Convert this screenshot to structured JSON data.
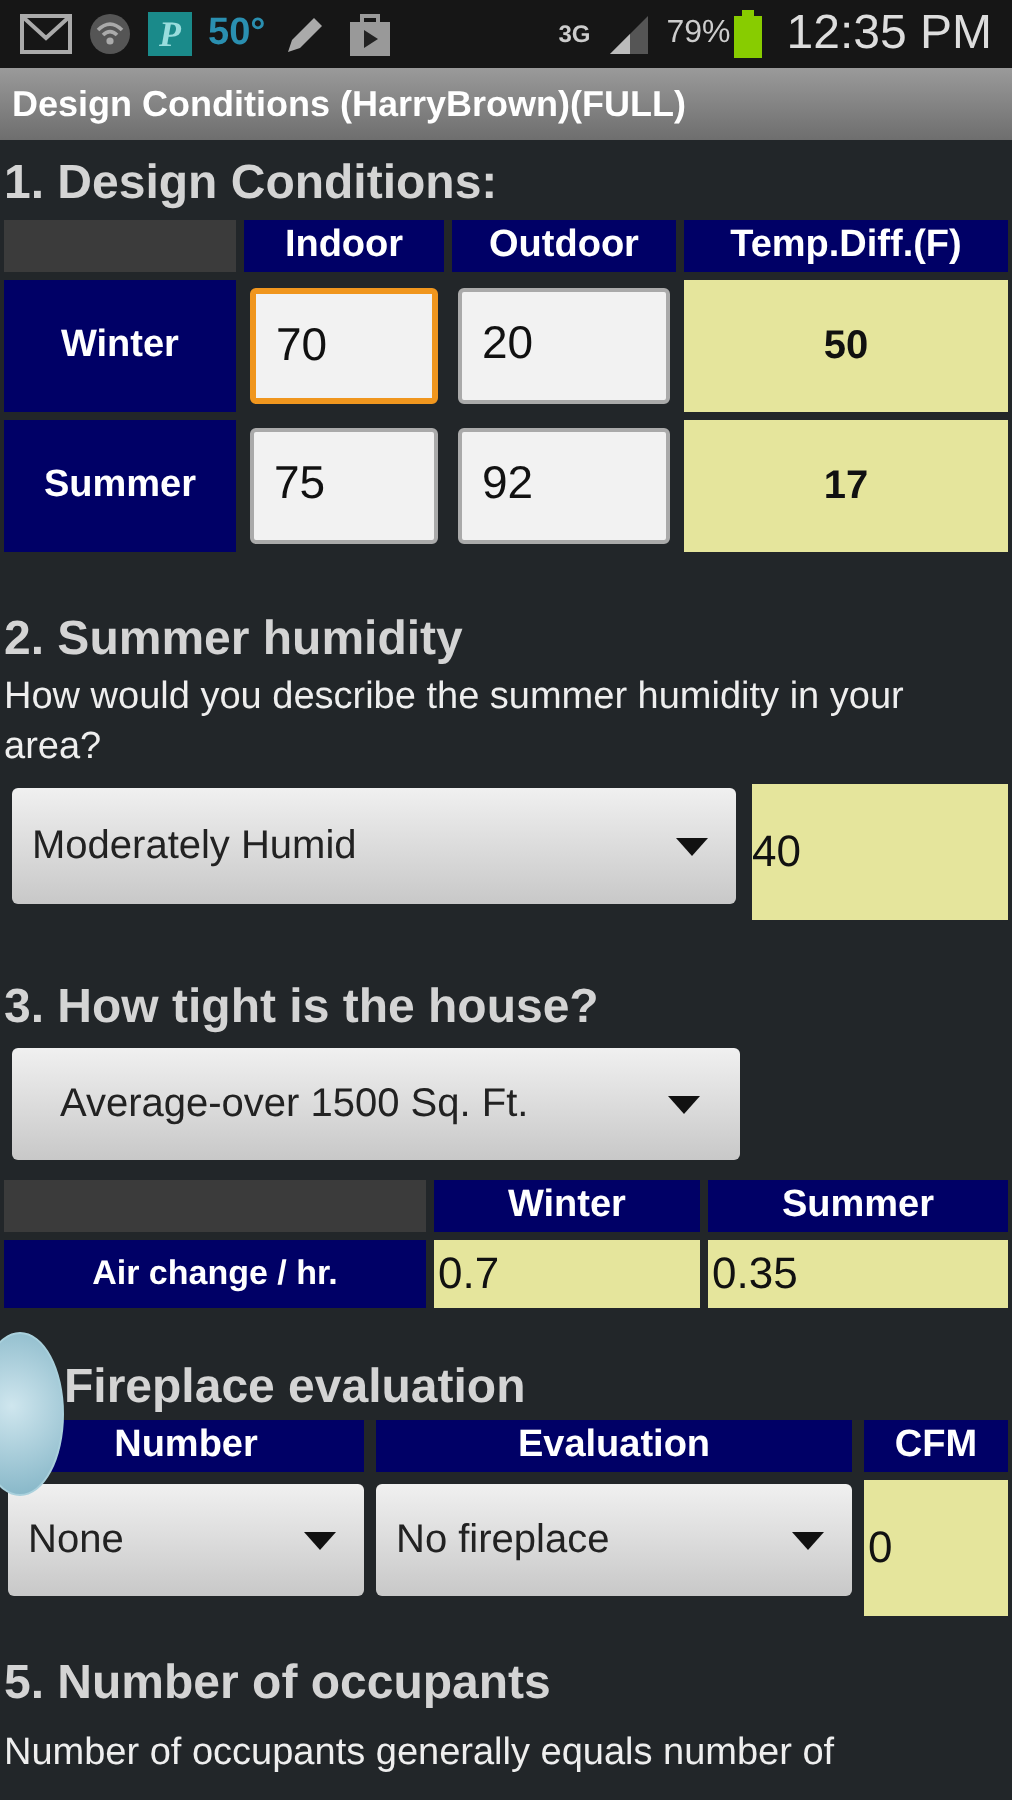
{
  "status_bar": {
    "notification_letter": "P",
    "temperature": "50°",
    "network": "3G",
    "battery": "79%",
    "time": "12:35 PM"
  },
  "title_bar": {
    "title": "Design Conditions (HarryBrown)(FULL)"
  },
  "design_conditions": {
    "title": "1. Design Conditions:",
    "columns": [
      "Indoor",
      "Outdoor",
      "Temp.Diff.(F)"
    ],
    "rows": [
      {
        "label": "Winter",
        "indoor": {
          "value": "70",
          "focused": true
        },
        "outdoor": {
          "value": "20",
          "focused": false
        },
        "temp_diff": "50"
      },
      {
        "label": "Summer",
        "indoor": {
          "value": "75",
          "focused": false
        },
        "outdoor": {
          "value": "92",
          "focused": false
        },
        "temp_diff": "17"
      }
    ]
  },
  "humidity": {
    "title": "2. Summer humidity",
    "question": "How would you describe the summer humidity in your area?",
    "select": "Moderately Humid",
    "value": "40"
  },
  "tightness": {
    "title": "3. How tight is the house?",
    "select": "Average-over 1500 Sq. Ft.",
    "columns": [
      "Winter",
      "Summer"
    ],
    "row": {
      "label": "Air change / hr.",
      "winter": "0.7",
      "summer": "0.35"
    }
  },
  "fireplace": {
    "title": "Fireplace evaluation",
    "columns": [
      "Number",
      "Evaluation",
      "CFM"
    ],
    "number": "None",
    "evaluation": "No fireplace",
    "cfm": "0"
  },
  "occupants": {
    "title": "5. Number of occupants",
    "description": "Number of occupants generally equals number of"
  }
}
